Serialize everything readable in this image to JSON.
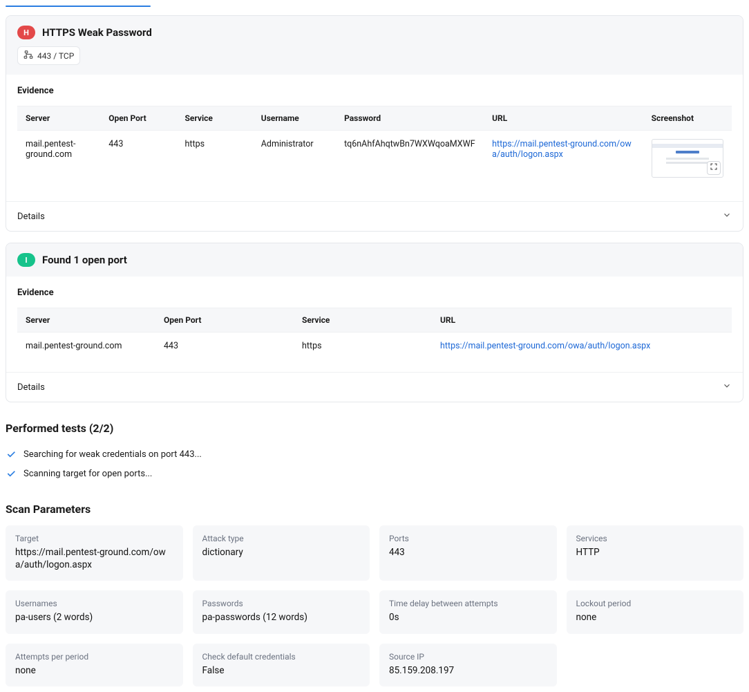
{
  "top_tab_indicator": true,
  "finding1": {
    "badge": "H",
    "title": "HTTPS Weak Password",
    "port_chip": "443 / TCP",
    "evidence_label": "Evidence",
    "table_headers": [
      "Server",
      "Open Port",
      "Service",
      "Username",
      "Password",
      "URL",
      "Screenshot"
    ],
    "row": {
      "server": "mail.pentest-ground.com",
      "open_port": "443",
      "service": "https",
      "username": "Administrator",
      "password": "tq6nAhfAhqtwBn7WXWqoaMXWF",
      "url": "https://mail.pentest-ground.com/owa/auth/logon.aspx"
    },
    "details_label": "Details"
  },
  "finding2": {
    "badge": "I",
    "title": "Found 1 open port",
    "evidence_label": "Evidence",
    "table_headers": [
      "Server",
      "Open Port",
      "Service",
      "URL"
    ],
    "row": {
      "server": "mail.pentest-ground.com",
      "open_port": "443",
      "service": "https",
      "url": "https://mail.pentest-ground.com/owa/auth/logon.aspx"
    },
    "details_label": "Details"
  },
  "performed_tests_heading": "Performed tests (2/2)",
  "tests": [
    "Searching for weak credentials on port 443...",
    "Scanning target for open ports..."
  ],
  "scan_params_heading": "Scan Parameters",
  "params": [
    {
      "label": "Target",
      "value": "https://mail.pentest-ground.com/owa/auth/logon.aspx"
    },
    {
      "label": "Attack type",
      "value": "dictionary"
    },
    {
      "label": "Ports",
      "value": "443"
    },
    {
      "label": "Services",
      "value": "HTTP"
    },
    {
      "label": "Usernames",
      "value": "pa-users (2 words)"
    },
    {
      "label": "Passwords",
      "value": "pa-passwords (12 words)"
    },
    {
      "label": "Time delay between attempts",
      "value": "0s"
    },
    {
      "label": "Lockout period",
      "value": "none"
    },
    {
      "label": "Attempts per period",
      "value": "none"
    },
    {
      "label": "Check default credentials",
      "value": "False"
    },
    {
      "label": "Source IP",
      "value": "85.159.208.197"
    }
  ]
}
